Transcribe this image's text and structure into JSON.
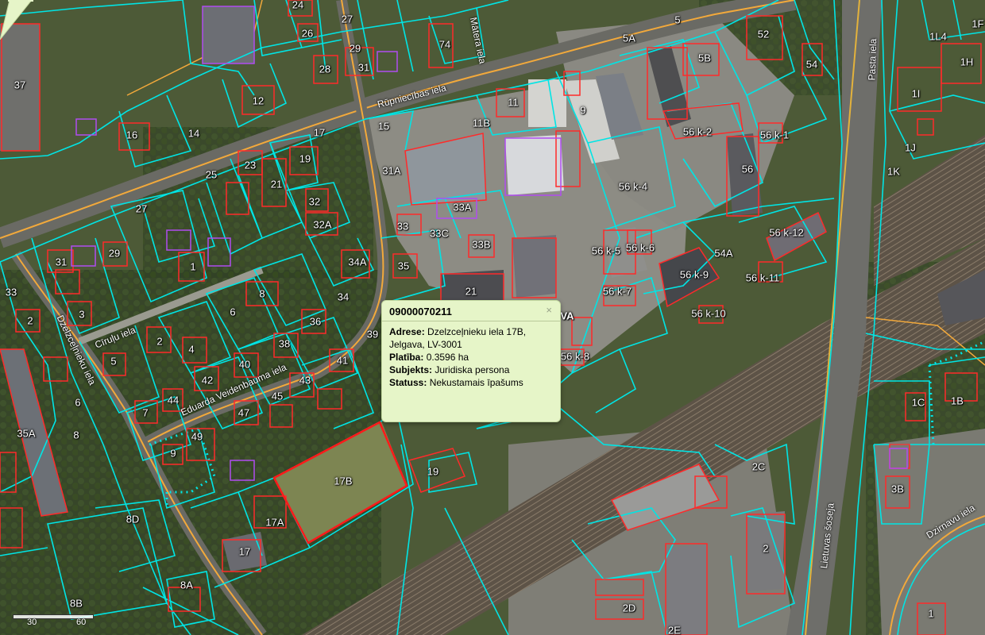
{
  "popup": {
    "title": "09000070211",
    "close": "×",
    "rows": [
      {
        "label": "Adrese:",
        "value": "Dzelzceļnieku iela 17B, Jelgava, LV-3001"
      },
      {
        "label": "Platība:",
        "value": "0.3596 ha"
      },
      {
        "label": "Subjekts:",
        "value": "Juridiska persona"
      },
      {
        "label": "Statuss:",
        "value": "Nekustamais īpašums"
      }
    ]
  },
  "partial_label": "VA",
  "scale": {
    "tick_30": "30",
    "tick_60": "60"
  },
  "colors": {
    "parcel": "#00e5e5",
    "building": "#ff2a2a",
    "selected": "#ff1a1a",
    "road": "#f2a93b",
    "purple": "#a020f0"
  },
  "streets": [
    {
      "name": "Rūpniecības iela"
    },
    {
      "name": "Mātera iela"
    },
    {
      "name": "Pasta iela"
    },
    {
      "name": "Dzelzceļnieku iela"
    },
    {
      "name": "Cīruļu iela"
    },
    {
      "name": "Eduarda Veidenbauma iela"
    },
    {
      "name": "Lietuvas šoseja"
    },
    {
      "name": "Dzirnavu iela"
    }
  ],
  "parcels": [
    "37",
    "24",
    "26",
    "27",
    "74",
    "29",
    "31",
    "28",
    "16",
    "14",
    "12",
    "11",
    "15",
    "11B",
    "17",
    "19",
    "23",
    "21",
    "25",
    "31A",
    "32",
    "32A",
    "27",
    "33",
    "33A",
    "33C",
    "33B",
    "31",
    "29",
    "1",
    "34A",
    "35",
    "21",
    "34",
    "8",
    "6",
    "36",
    "38",
    "33",
    "3",
    "2",
    "4",
    "Dzelzceļnieku",
    "5",
    "2",
    "40",
    "39",
    "42",
    "41",
    "43",
    "44",
    "45",
    "7",
    "6",
    "47",
    "49",
    "9",
    "35A",
    "8",
    "17B",
    "19",
    "17A",
    "17",
    "8D",
    "8A",
    "8B",
    "9",
    "5A",
    "5",
    "52",
    "54",
    "5B",
    "56 k-2",
    "56 k-1",
    "56",
    "56 k-4",
    "56 k-5",
    "56 k-6",
    "56 k-12",
    "54A",
    "56 k-9",
    "56 k-11",
    "56 k-7",
    "56 k-10",
    "56 k-8",
    "1L4",
    "1F",
    "1H",
    "1I",
    "1J",
    "1K",
    "1C",
    "1B",
    "2C",
    "3B",
    "2",
    "2D",
    "2E",
    "1"
  ]
}
